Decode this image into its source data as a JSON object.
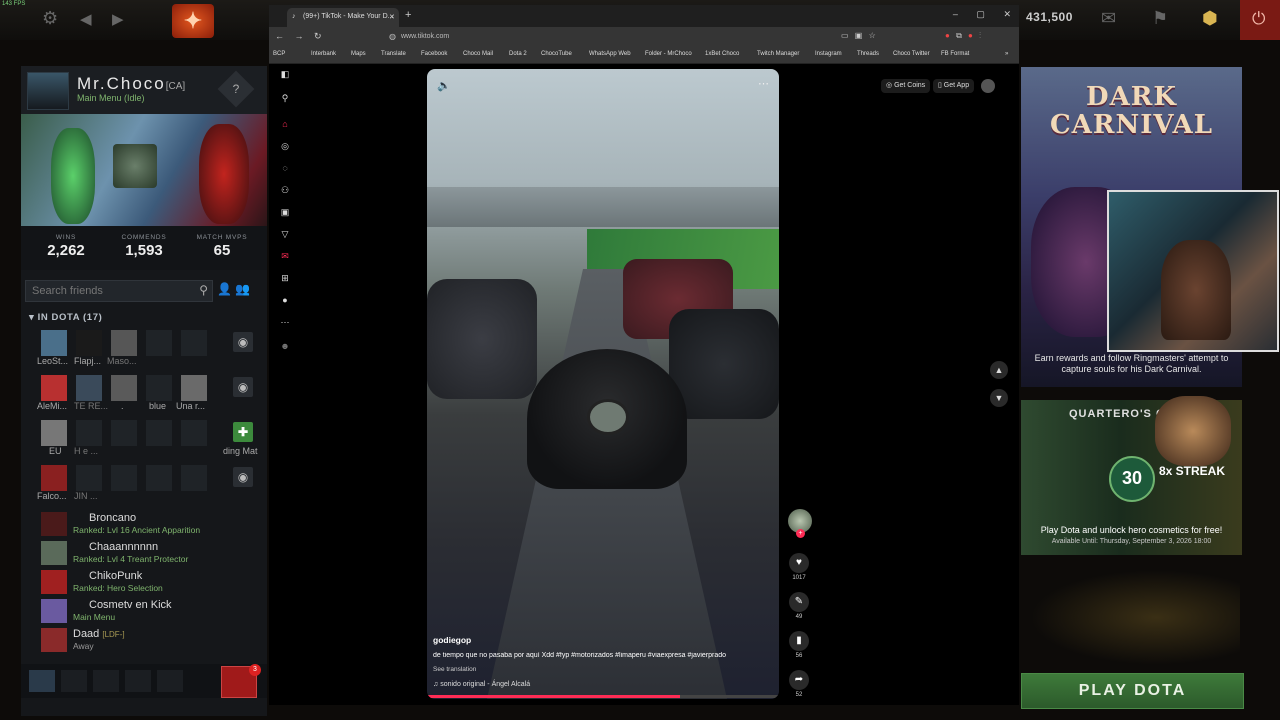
{
  "system": {
    "fps": "143 FPS"
  },
  "dota_top": {
    "gold": "431,500"
  },
  "profile": {
    "name": "Mr.Choco",
    "tag": "[CA]",
    "status": "Main Menu (Idle)",
    "stats": [
      {
        "label": "WINS",
        "value": "2,262"
      },
      {
        "label": "COMMENDS",
        "value": "1,593"
      },
      {
        "label": "MATCH MVPS",
        "value": "65"
      }
    ]
  },
  "friends": {
    "search_placeholder": "Search friends",
    "in_dota_header": "IN DOTA (17)",
    "tile_names": [
      "LeoSt...",
      "Flapj...",
      "Maso...",
      "AleMi...",
      "TE RE...",
      ".",
      "blue",
      "Una r...",
      "EU",
      "H e ...",
      "ding Mat",
      "Falco...",
      "JIN ..."
    ],
    "list": [
      {
        "name": "Broncano",
        "sub": "Ranked: Lvl 16 Ancient Apparition"
      },
      {
        "name": "Chaaannnnnn",
        "sub": "Ranked: Lvl 4 Treant Protector"
      },
      {
        "name": "ChikoPunk",
        "sub": "Ranked: Hero Selection"
      },
      {
        "name": "Cosmetv en Kick",
        "sub": "Main Menu"
      },
      {
        "name": "Daad",
        "tag": "[LDF-]",
        "sub": "Away"
      }
    ],
    "notification_count": "3"
  },
  "browser": {
    "tab_title": "(99+) TikTok - Make Your D...",
    "url": "www.tiktok.com",
    "bookmarks": [
      "BCP",
      "Interbank",
      "Maps",
      "Translate",
      "Facebook",
      "Choco Mail",
      "Dota 2",
      "ChocoTube",
      "WhatsApp Web",
      "Folder - MrChoco",
      "1xBet Choco",
      "Twitch Manager",
      "Instagram",
      "Threads",
      "Choco Twitter",
      "FB Format"
    ]
  },
  "tiktok": {
    "get_coins": "Get Coins",
    "get_app": "Get App",
    "username": "godiegop",
    "caption": "de tiempo que no pasaba por aquí Xdd #fyp #motorizados #limaperu #viaexpresa #javierprado",
    "see_translation": "See translation",
    "sound": "sonido original - Ángel Alcalá",
    "likes": "1017",
    "comments": "49",
    "saves": "56",
    "shares": "52",
    "progress": 0.72
  },
  "right": {
    "carnival_title": "DARK CARNIVAL",
    "carnival_text": "Earn rewards and follow Ringmasters' attempt to capture souls for his Dark Carnival.",
    "quartero_title": "QUARTERO'S C",
    "streak_num": "30",
    "streak_label": "8x STREAK",
    "quartero_text": "Play Dota and unlock hero cosmetics for free!",
    "quartero_avail": "Available Until: Thursday, September 3, 2026 18:00",
    "play_button": "PLAY DOTA"
  },
  "colors": {
    "accent_green": "#3e7a3a",
    "tiktok_red": "#fe2c55"
  }
}
